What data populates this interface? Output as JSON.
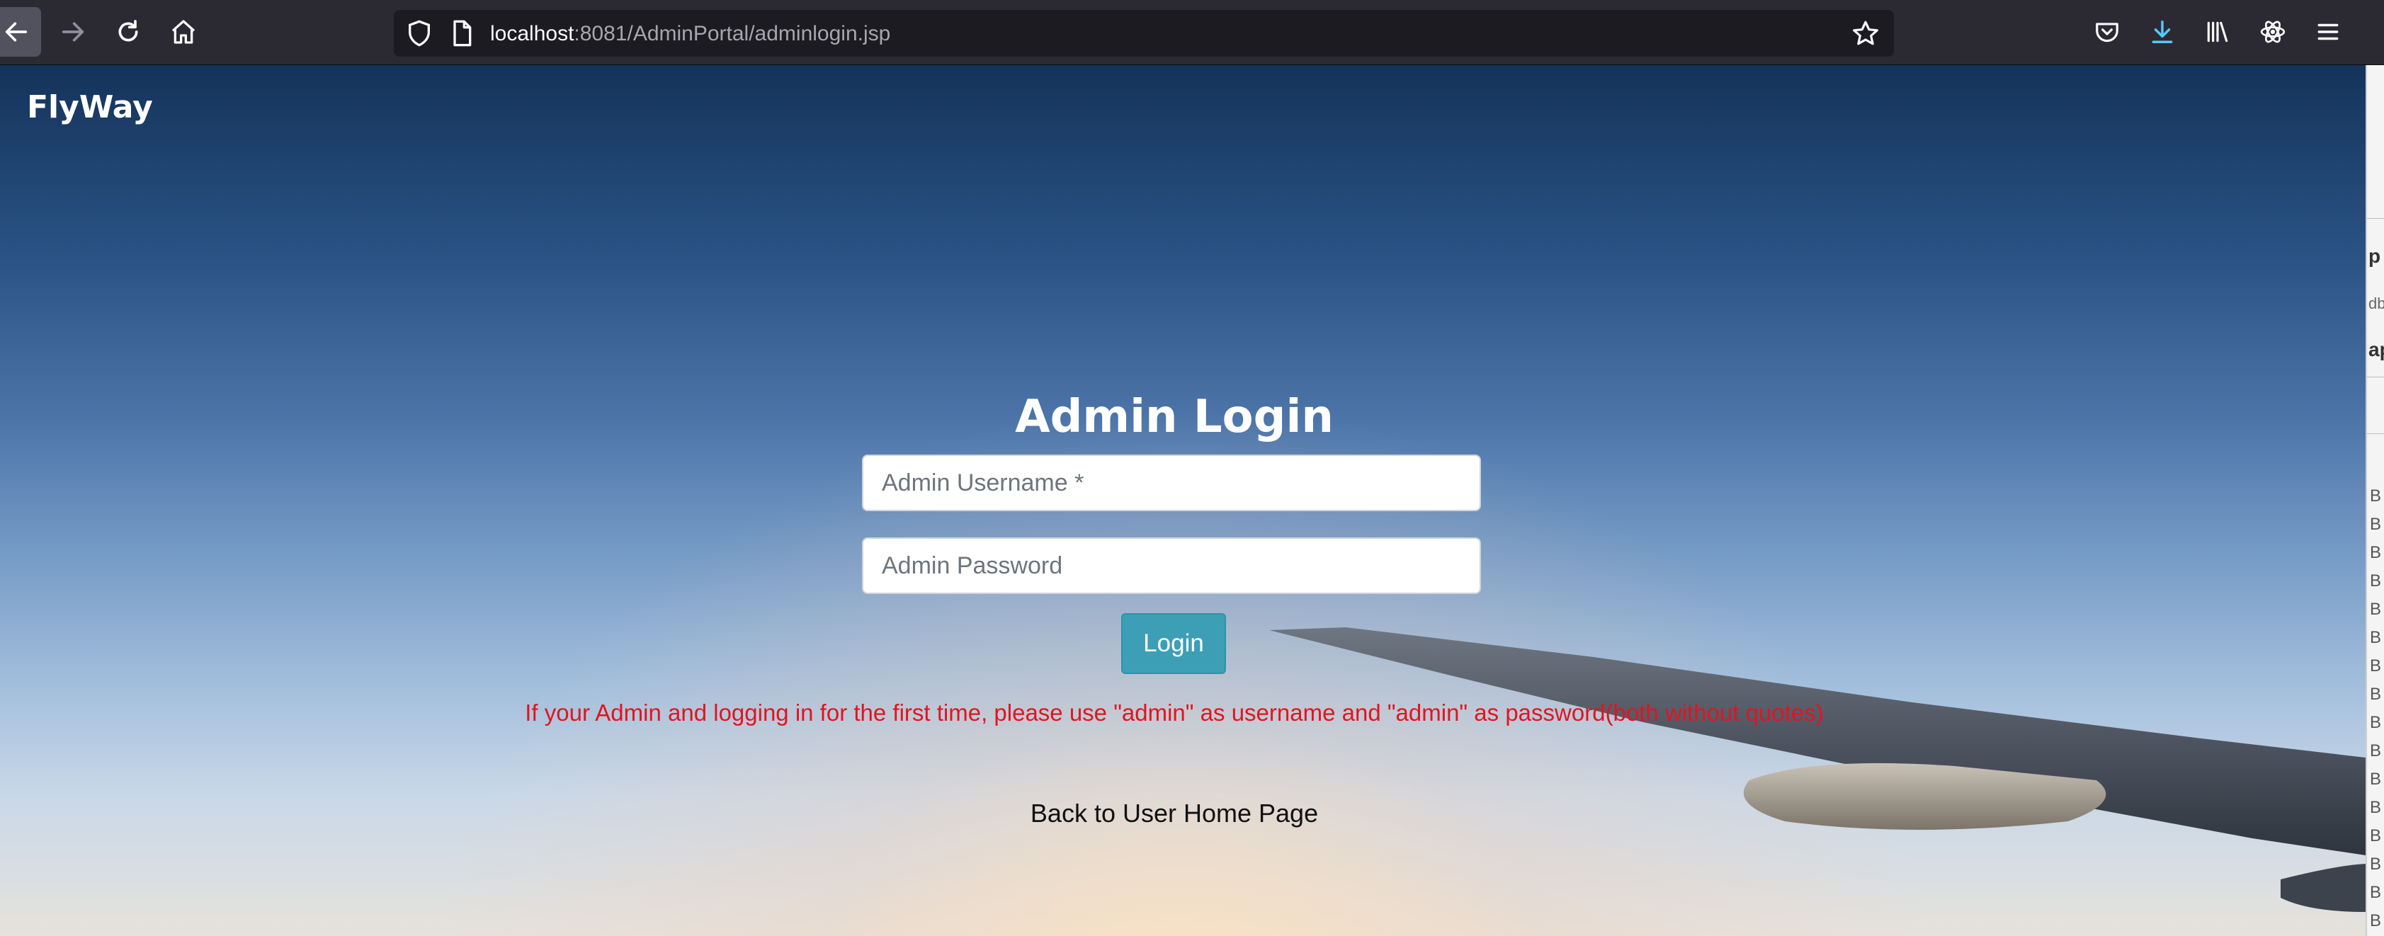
{
  "browser": {
    "url_host": "localhost",
    "url_path": ":8081/AdminPortal/adminlogin.jsp",
    "icons": [
      "back-icon",
      "forward-icon",
      "reload-icon",
      "home-icon",
      "shield-icon",
      "page-icon",
      "star-icon",
      "pocket-icon",
      "download-icon",
      "library-icon",
      "extension-icon",
      "menu-icon"
    ]
  },
  "page": {
    "brand": "FlyWay",
    "title": "Admin Login",
    "username_placeholder": "Admin Username *",
    "password_placeholder": "Admin Password",
    "login_label": "Login",
    "hint": "If your Admin and logging in for the first time, please use \"admin\" as username and \"admin\" as password(both without quotes)",
    "back_link": "Back to User Home Page"
  },
  "edge_panel": {
    "fragments": [
      "p",
      "db",
      "ap"
    ],
    "rows": [
      "B",
      "B",
      "B",
      "B",
      "B",
      "B",
      "B",
      "B",
      "B",
      "B",
      "B",
      "B",
      "B",
      "B",
      "B",
      "B"
    ]
  },
  "colors": {
    "toolbar": "#2b2a33",
    "urlbar": "#1c1b22",
    "button": "#3c9fb6",
    "hint": "#e2141f",
    "download_accent": "#54c8ff"
  }
}
